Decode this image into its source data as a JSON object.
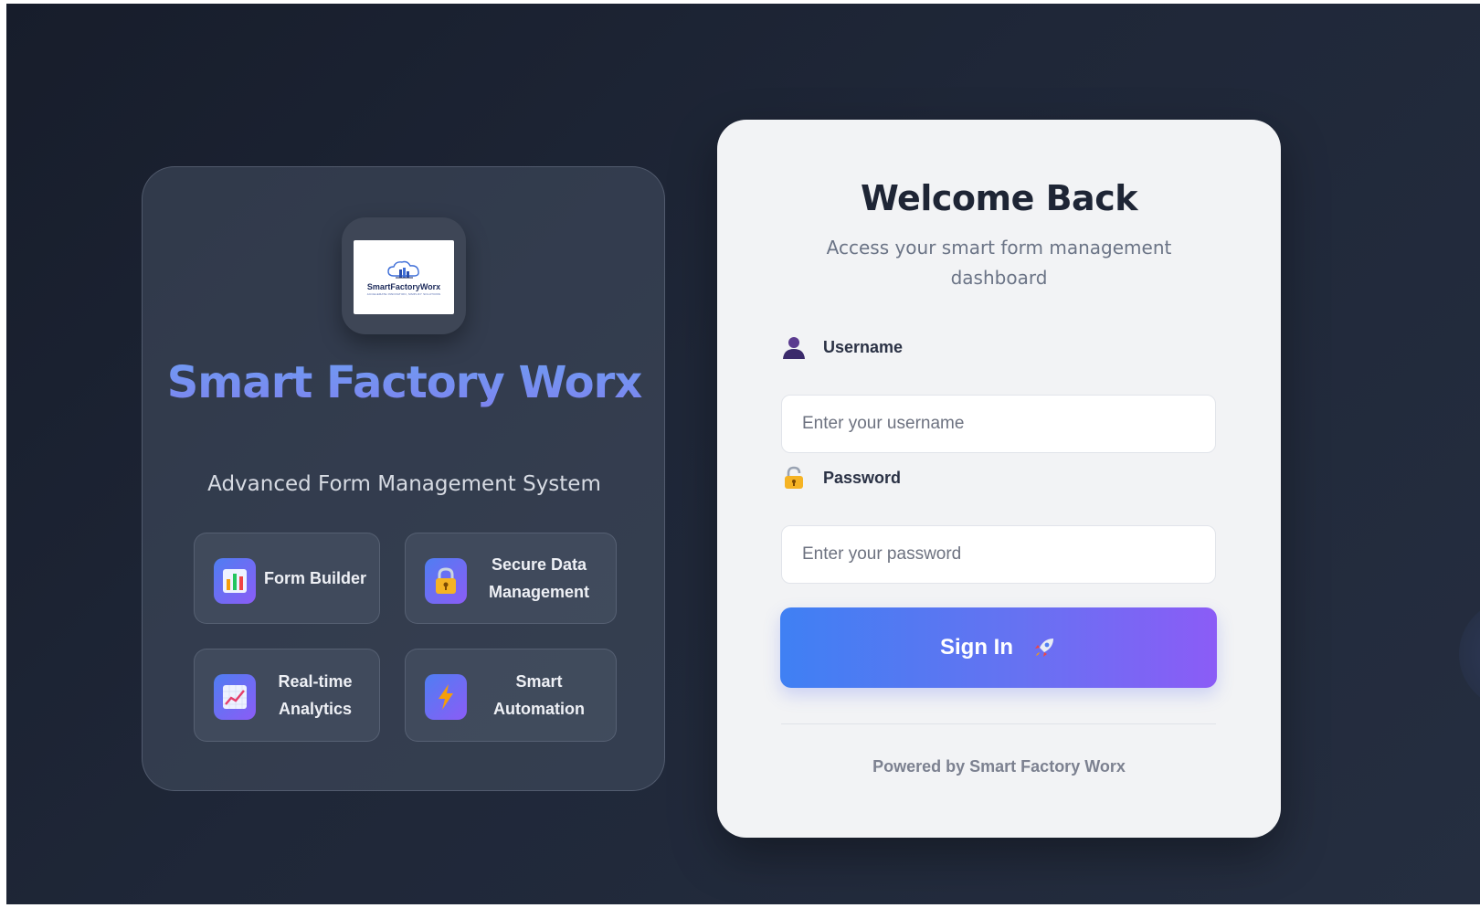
{
  "brand": {
    "logo_text": "SmartFactoryWorx",
    "logo_tagline": "ACCELERATE INNOVATION, SIMPLIFY SOLUTIONS",
    "title": "Smart Factory Worx",
    "subtitle": "Advanced Form Management System",
    "features": [
      {
        "label": "Form Builder",
        "icon": "bar-chart-icon"
      },
      {
        "label": "Secure Data Management",
        "icon": "lock-icon"
      },
      {
        "label": "Real-time Analytics",
        "icon": "line-chart-icon"
      },
      {
        "label": "Smart Automation",
        "icon": "lightning-icon"
      }
    ]
  },
  "login": {
    "title": "Welcome Back",
    "subtitle": "Access your smart form management dashboard",
    "username": {
      "label": "Username",
      "placeholder": "Enter your username",
      "icon": "user-icon"
    },
    "password": {
      "label": "Password",
      "placeholder": "Enter your password",
      "icon": "lock-icon"
    },
    "submit_label": "Sign In",
    "submit_icon": "rocket-icon",
    "footer": "Powered by Smart Factory Worx"
  },
  "colors": {
    "background": "#1f2738",
    "accent_start": "#3f80f3",
    "accent_end": "#8b5cf6",
    "card": "#f2f3f5"
  }
}
